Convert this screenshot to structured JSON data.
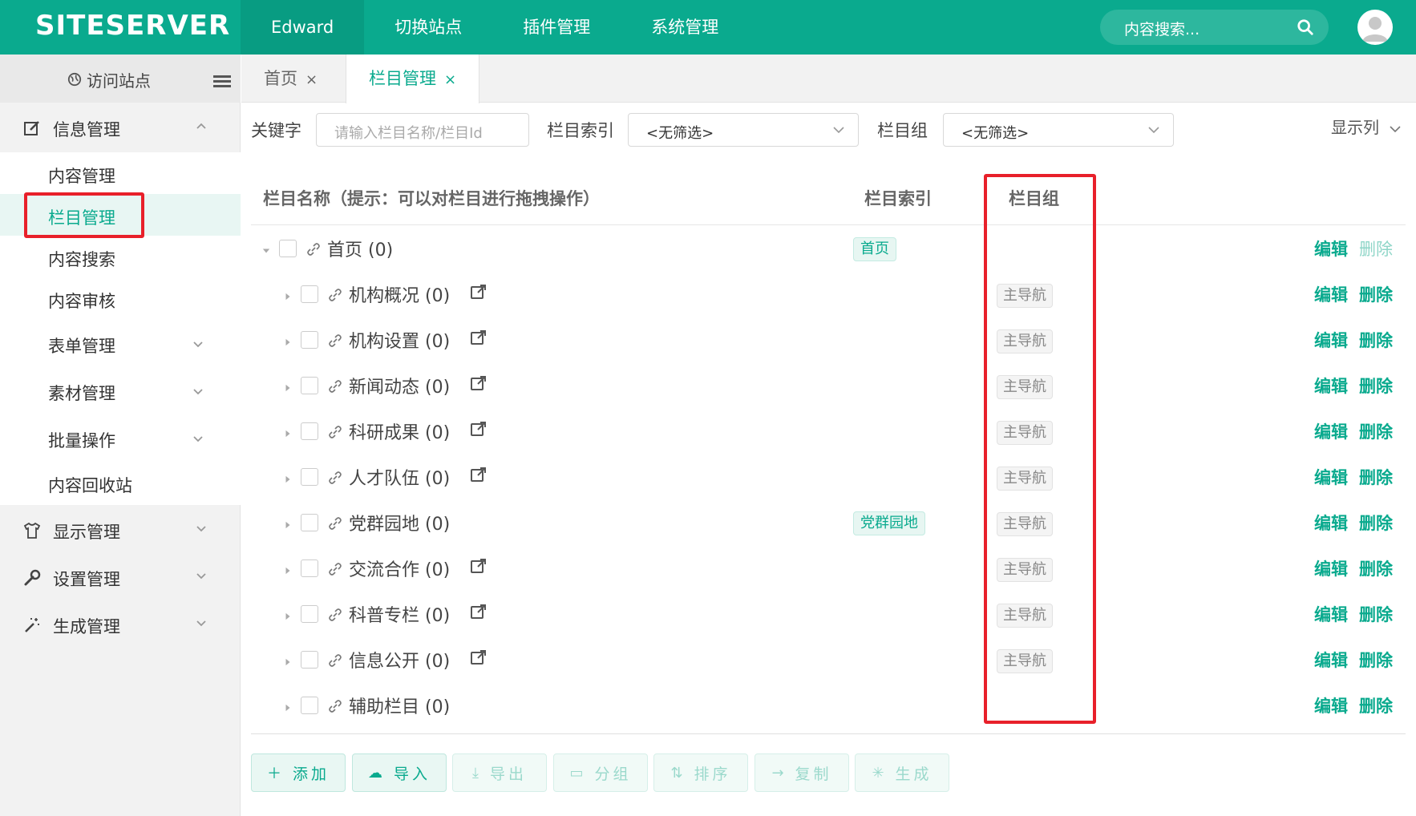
{
  "topbar": {
    "logo": "SITESERVER",
    "nav": [
      "Edward",
      "切换站点",
      "插件管理",
      "系统管理"
    ],
    "search_placeholder": "内容搜索..."
  },
  "sidebar": {
    "visit_label": "访问站点",
    "groups": {
      "info": "信息管理",
      "display": "显示管理",
      "settings": "设置管理",
      "generate": "生成管理"
    },
    "sub": {
      "content": "内容管理",
      "channel": "栏目管理",
      "search": "内容搜索",
      "review": "内容审核",
      "form": "表单管理",
      "material": "素材管理",
      "batch": "批量操作",
      "recycle": "内容回收站"
    }
  },
  "tabs": {
    "home": "首页",
    "channel": "栏目管理",
    "close": "×"
  },
  "filters": {
    "keyword_label": "关键字",
    "keyword_placeholder": "请输入栏目名称/栏目Id",
    "index_label": "栏目索引",
    "index_value": "<无筛选>",
    "group_label": "栏目组",
    "group_value": "<无筛选>",
    "columns_toggle": "显示列"
  },
  "table": {
    "headers": {
      "name": "栏目名称（提示：可以对栏目进行拖拽操作）",
      "index": "栏目索引",
      "group": "栏目组"
    },
    "edit_label": "编辑",
    "delete_label": "删除",
    "rows": [
      {
        "name": "首页 (0)",
        "index": "首页",
        "group": ""
      },
      {
        "name": "机构概况 (0)",
        "index": "",
        "group": "主导航"
      },
      {
        "name": "机构设置 (0)",
        "index": "",
        "group": "主导航"
      },
      {
        "name": "新闻动态 (0)",
        "index": "",
        "group": "主导航"
      },
      {
        "name": "科研成果 (0)",
        "index": "",
        "group": "主导航"
      },
      {
        "name": "人才队伍 (0)",
        "index": "",
        "group": "主导航"
      },
      {
        "name": "党群园地 (0)",
        "index": "党群园地",
        "group": "主导航"
      },
      {
        "name": "交流合作 (0)",
        "index": "",
        "group": "主导航"
      },
      {
        "name": "科普专栏 (0)",
        "index": "",
        "group": "主导航"
      },
      {
        "name": "信息公开 (0)",
        "index": "",
        "group": "主导航"
      },
      {
        "name": "辅助栏目 (0)",
        "index": "",
        "group": ""
      }
    ]
  },
  "buttons": {
    "add": "添加",
    "import": "导入",
    "export": "导出",
    "group": "分组",
    "sort": "排序",
    "copy": "复制",
    "generate": "生成"
  },
  "colors": {
    "accent": "#0aaa8e",
    "highlight": "#e8202a"
  }
}
